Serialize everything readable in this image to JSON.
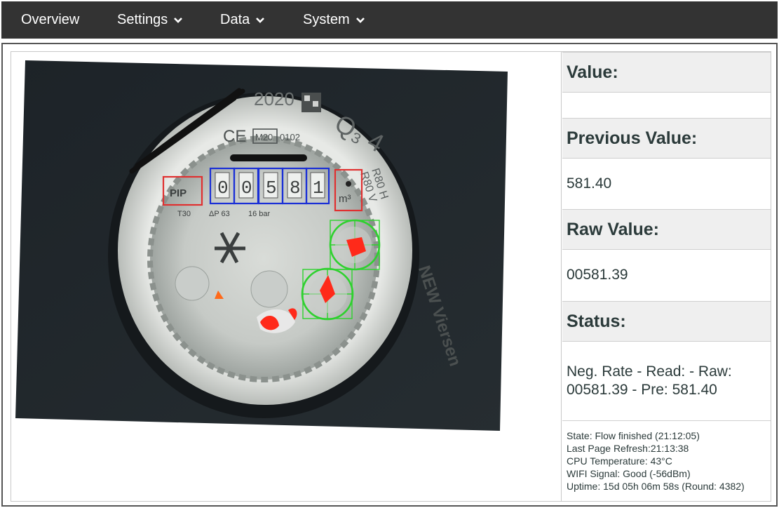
{
  "nav": {
    "items": [
      {
        "label": "Overview",
        "has_dropdown": false
      },
      {
        "label": "Settings",
        "has_dropdown": true
      },
      {
        "label": "Data",
        "has_dropdown": true
      },
      {
        "label": "System",
        "has_dropdown": true
      }
    ]
  },
  "meter_image": {
    "year_text": "2020",
    "ce_text": "CE",
    "m_mark": "M20",
    "notified_body": "0102",
    "q3_text": "Q₃ 4",
    "r_text": "R80 H",
    "r_text2": "R80 V",
    "pip_label": "PIP",
    "t_label": "T30",
    "dp_label": "ΔP 63",
    "bar_label": "16 bar",
    "unit_label": "m³",
    "digits": [
      "0",
      "0",
      "5",
      "8",
      "1"
    ],
    "brand_text": "NEW Viersen",
    "colors": {
      "digit_roi": "#1a2fd6",
      "ref_roi": "#e03030",
      "analog_roi": "#2ed12e",
      "pointer": "#ff2a1a"
    }
  },
  "panel": {
    "value_label": "Value:",
    "value": "",
    "previous_label": "Previous Value:",
    "previous": "581.40",
    "raw_label": "Raw Value:",
    "raw": "00581.39",
    "status_label": "Status:",
    "status": "Neg. Rate - Read: - Raw: 00581.39 - Pre: 581.40"
  },
  "info": {
    "state": "State: Flow finished (21:12:05)",
    "refresh": "Last Page Refresh:21:13:38",
    "cpu": "CPU Temperature: 43°C",
    "wifi": "WIFI Signal: Good (-56dBm)",
    "uptime": "Uptime: 15d 05h 06m 58s (Round: 4382)"
  }
}
